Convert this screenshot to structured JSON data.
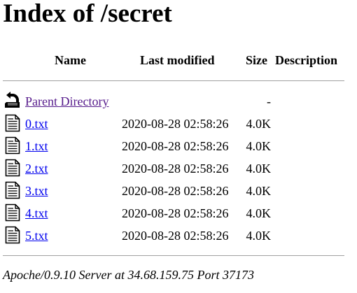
{
  "page": {
    "title": "Index of /secret"
  },
  "table": {
    "headers": {
      "name": "Name",
      "last_modified": "Last modified",
      "size": "Size",
      "description": "Description"
    },
    "parent": {
      "label": "Parent Directory",
      "date": "",
      "size": "-",
      "icon": "back-icon"
    },
    "rows": [
      {
        "name": "0.txt",
        "date": "2020-08-28 02:58:26",
        "size": "4.0K",
        "icon": "text-file-icon"
      },
      {
        "name": "1.txt",
        "date": "2020-08-28 02:58:26",
        "size": "4.0K",
        "icon": "text-file-icon"
      },
      {
        "name": "2.txt",
        "date": "2020-08-28 02:58:26",
        "size": "4.0K",
        "icon": "text-file-icon"
      },
      {
        "name": "3.txt",
        "date": "2020-08-28 02:58:26",
        "size": "4.0K",
        "icon": "text-file-icon"
      },
      {
        "name": "4.txt",
        "date": "2020-08-28 02:58:26",
        "size": "4.0K",
        "icon": "text-file-icon"
      },
      {
        "name": "5.txt",
        "date": "2020-08-28 02:58:26",
        "size": "4.0K",
        "icon": "text-file-icon"
      }
    ]
  },
  "footer": {
    "text": "Apoche/0.9.10 Server at 34.68.159.75 Port 37173"
  },
  "colors": {
    "link": "#0000ee",
    "visited_link": "#551a8b",
    "rule": "#a0a0a0"
  }
}
